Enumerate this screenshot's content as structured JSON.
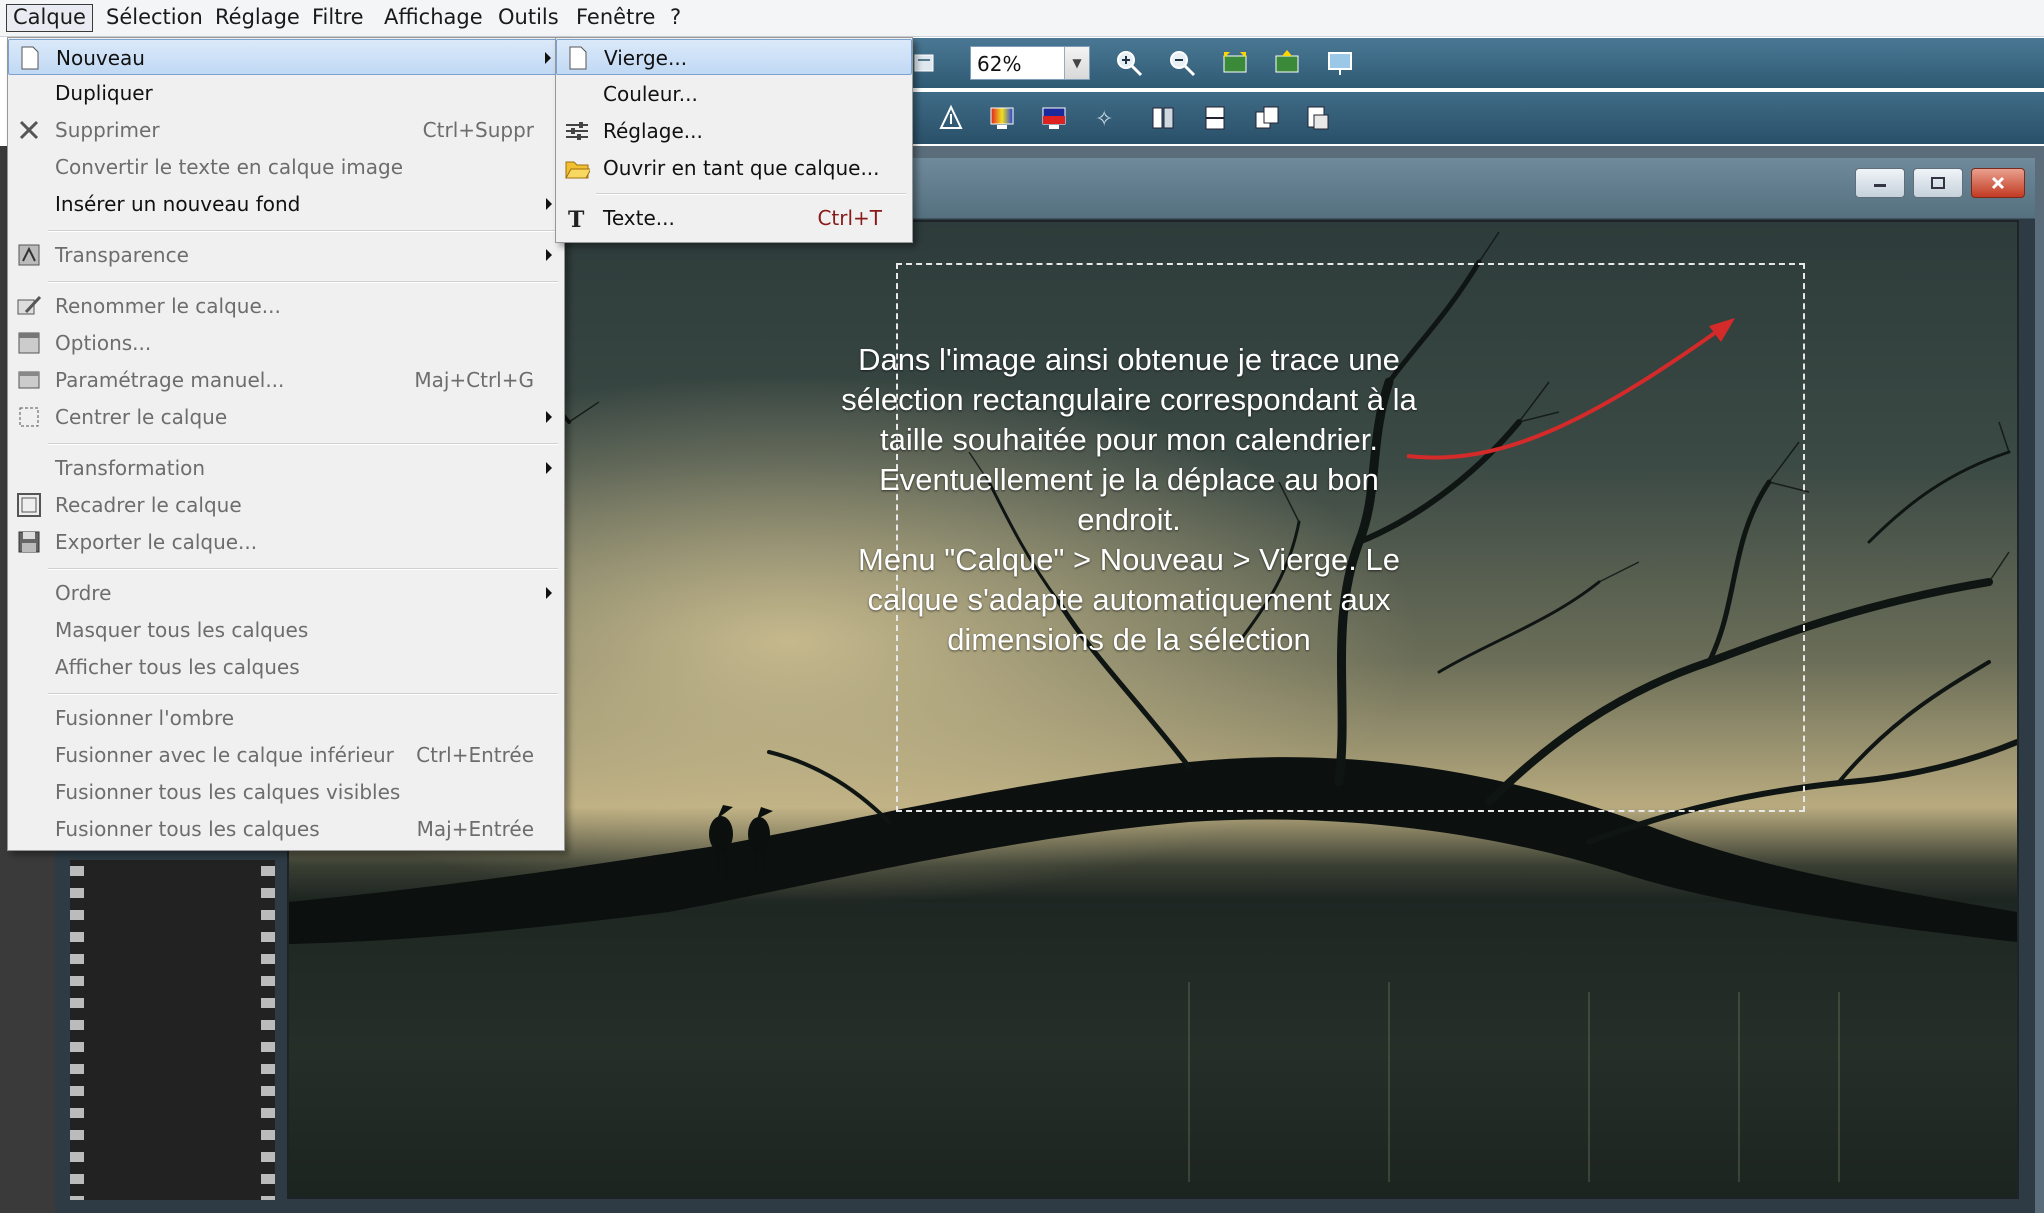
{
  "menubar": {
    "items": [
      "Calque",
      "Sélection",
      "Réglage",
      "Filtre",
      "Affichage",
      "Outils",
      "Fenêtre",
      "?"
    ]
  },
  "toolbar": {
    "zoom_value": "62%",
    "icons_row1": [
      "layer-icon",
      "zoom-in-icon",
      "zoom-out-icon",
      "fit-image-icon",
      "actual-size-icon",
      "fullscreen-icon"
    ],
    "icons_row2": [
      "sharpen-icon",
      "colors-icon",
      "gradient-icon",
      "stars-icon",
      "flip-icon",
      "rotate-icon",
      "copy-icon",
      "paste-icon"
    ]
  },
  "menu_calque": {
    "items": [
      {
        "label": "Nouveau",
        "shortcut": "",
        "submenu": true,
        "enabled": true,
        "icon": "blank-page-icon"
      },
      {
        "label": "Dupliquer",
        "shortcut": "",
        "submenu": false,
        "enabled": true,
        "icon": ""
      },
      {
        "label": "Supprimer",
        "shortcut": "Ctrl+Suppr",
        "submenu": false,
        "enabled": false,
        "icon": "delete-x-icon"
      },
      {
        "label": "Convertir le texte en calque image",
        "shortcut": "",
        "submenu": false,
        "enabled": false,
        "icon": ""
      },
      {
        "label": "Insérer un nouveau fond",
        "shortcut": "",
        "submenu": true,
        "enabled": true,
        "icon": ""
      },
      {
        "label": "Transparence",
        "shortcut": "",
        "submenu": true,
        "enabled": false,
        "icon": "transparency-icon"
      },
      {
        "label": "Renommer le calque...",
        "shortcut": "",
        "submenu": false,
        "enabled": false,
        "icon": "rename-icon"
      },
      {
        "label": "Options...",
        "shortcut": "",
        "submenu": false,
        "enabled": false,
        "icon": "options-icon"
      },
      {
        "label": "Paramétrage manuel...",
        "shortcut": "Maj+Ctrl+G",
        "submenu": false,
        "enabled": false,
        "icon": "manual-settings-icon"
      },
      {
        "label": "Centrer le calque",
        "shortcut": "",
        "submenu": true,
        "enabled": false,
        "icon": "center-icon"
      },
      {
        "label": "Transformation",
        "shortcut": "",
        "submenu": true,
        "enabled": false,
        "icon": ""
      },
      {
        "label": "Recadrer le calque",
        "shortcut": "",
        "submenu": false,
        "enabled": false,
        "icon": "crop-icon"
      },
      {
        "label": "Exporter le calque...",
        "shortcut": "",
        "submenu": false,
        "enabled": false,
        "icon": "save-disk-icon"
      },
      {
        "label": "Ordre",
        "shortcut": "",
        "submenu": true,
        "enabled": false,
        "icon": ""
      },
      {
        "label": "Masquer tous les calques",
        "shortcut": "",
        "submenu": false,
        "enabled": false,
        "icon": ""
      },
      {
        "label": "Afficher tous les calques",
        "shortcut": "",
        "submenu": false,
        "enabled": false,
        "icon": ""
      },
      {
        "label": "Fusionner l'ombre",
        "shortcut": "",
        "submenu": false,
        "enabled": false,
        "icon": ""
      },
      {
        "label": "Fusionner avec le calque inférieur",
        "shortcut": "Ctrl+Entrée",
        "submenu": false,
        "enabled": false,
        "icon": ""
      },
      {
        "label": "Fusionner tous les calques visibles",
        "shortcut": "",
        "submenu": false,
        "enabled": false,
        "icon": ""
      },
      {
        "label": "Fusionner tous les calques",
        "shortcut": "Maj+Entrée",
        "submenu": false,
        "enabled": false,
        "icon": ""
      }
    ]
  },
  "menu_nouveau": {
    "items": [
      {
        "label": "Vierge...",
        "shortcut": "",
        "icon": "blank-page-icon"
      },
      {
        "label": "Couleur...",
        "shortcut": "",
        "icon": ""
      },
      {
        "label": "Réglage...",
        "shortcut": "",
        "icon": "adjustment-icon"
      },
      {
        "label": "Ouvrir en tant que calque...",
        "shortcut": "",
        "icon": "open-folder-icon"
      },
      {
        "label": "Texte...",
        "shortcut": "Ctrl+T",
        "icon": "text-icon"
      }
    ]
  },
  "annotation": {
    "lines": [
      "Dans l'image ainsi obtenue je trace une",
      "sélection rectangulaire correspondant à la",
      "taille souhaitée pour mon calendrier.",
      "Eventuellement je la déplace au bon",
      "endroit.",
      "Menu \"Calque\" > Nouveau > Vierge. Le",
      "calque s'adapte automatiquement aux",
      "dimensions de la sélection"
    ]
  },
  "colors": {
    "arrow": "#d42a2a",
    "menu_bg": "#f0f0f0",
    "menu_highlight": "#c1d9f4",
    "toolbar": "#3f6b86"
  }
}
